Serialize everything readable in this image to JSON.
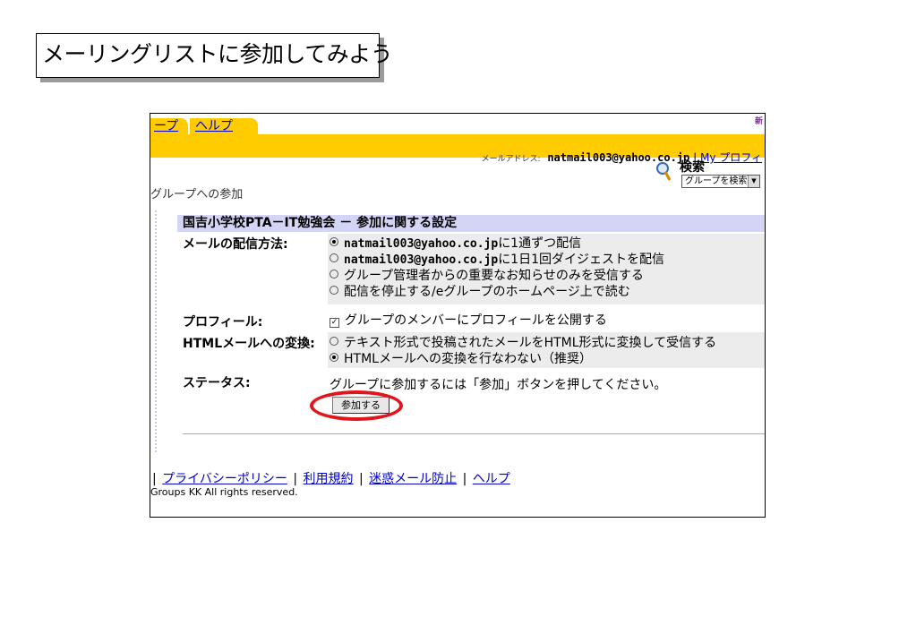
{
  "slide_title": "メーリングリストに参加してみよう",
  "tabs": {
    "groups": "ープ",
    "help": "ヘルプ"
  },
  "new_tag": "新",
  "mail": {
    "label": "メールアドレス:",
    "address": "natmail003@yahoo.co.jp",
    "sep": "|",
    "profile_link": "My プロフィ"
  },
  "search": {
    "label": "検索",
    "select_value": "グループを検索"
  },
  "page_heading": "グループへの参加",
  "panel_title": "国吉小学校PTA－IT勉強会 － 参加に関する設定",
  "delivery": {
    "label": "メールの配信方法:",
    "options": [
      {
        "prefix": "natmail003@yahoo.co.jp",
        "text": "に1通ずつ配信",
        "selected": true
      },
      {
        "prefix": "natmail003@yahoo.co.jp",
        "text": "に1日1回ダイジェストを配信",
        "selected": false
      },
      {
        "prefix": "",
        "text": "グループ管理者からの重要なお知らせのみを受信する",
        "selected": false
      },
      {
        "prefix": "",
        "text": "配信を停止する/eグループのホームページ上で読む",
        "selected": false
      }
    ]
  },
  "profile": {
    "label": "プロフィール:",
    "option": "グループのメンバーにプロフィールを公開する",
    "checked": true
  },
  "html_mail": {
    "label": "HTMLメールへの変換:",
    "options": [
      {
        "text": "テキスト形式で投稿されたメールをHTML形式に変換して受信する",
        "selected": false
      },
      {
        "text": "HTMLメールへの変換を行なわない（推奨）",
        "selected": true
      }
    ]
  },
  "status": {
    "label": "ステータス:",
    "text": "グループに参加するには「参加」ボタンを押してください。"
  },
  "join_button": "参加する",
  "footer": {
    "leading_bar": "|",
    "links": [
      "プライバシーポリシー",
      "利用規約",
      "迷惑メール防止",
      "ヘルプ"
    ],
    "copyright": "Groups KK All rights reserved."
  },
  "colors": {
    "accent": "#ffcc00",
    "panel": "#d4d4f4",
    "link": "#0000cc",
    "highlight": "#e0161c"
  }
}
